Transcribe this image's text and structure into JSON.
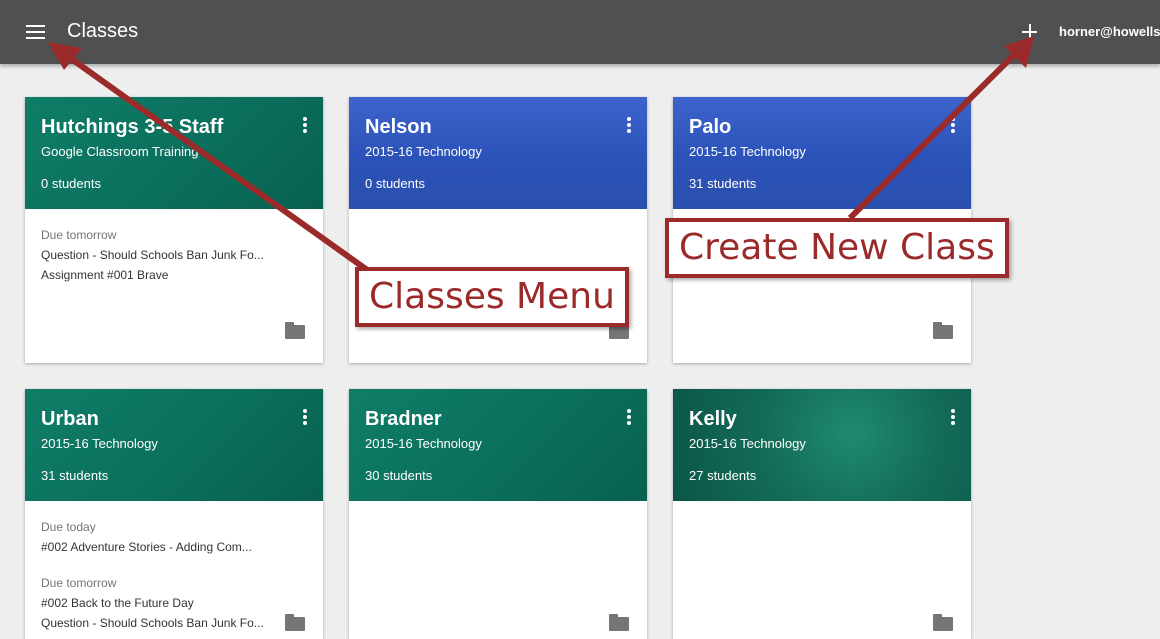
{
  "header": {
    "title": "Classes",
    "account": "horner@howellsc"
  },
  "classes": [
    {
      "name": "Hutchings 3-5 Staff",
      "section": "Google Classroom Training",
      "students": "0 students",
      "theme": "teal",
      "assignments": [
        {
          "due": "Due tomorrow",
          "items": [
            "Question - Should Schools Ban Junk Fo...",
            "Assignment #001 Brave"
          ]
        }
      ]
    },
    {
      "name": "Nelson",
      "section": "2015-16 Technology",
      "students": "0 students",
      "theme": "blue",
      "assignments": []
    },
    {
      "name": "Palo",
      "section": "2015-16 Technology",
      "students": "31 students",
      "theme": "blue",
      "assignments": []
    },
    {
      "name": "Urban",
      "section": "2015-16 Technology",
      "students": "31 students",
      "theme": "teal",
      "assignments": [
        {
          "due": "Due today",
          "items": [
            "#002 Adventure Stories - Adding Com..."
          ]
        },
        {
          "due": "Due tomorrow",
          "items": [
            "#002 Back to the Future Day",
            "Question - Should Schools Ban Junk Fo..."
          ]
        }
      ]
    },
    {
      "name": "Bradner",
      "section": "2015-16 Technology",
      "students": "30 students",
      "theme": "teal",
      "assignments": []
    },
    {
      "name": "Kelly",
      "section": "2015-16 Technology",
      "students": "27 students",
      "theme": "butterfly",
      "assignments": []
    }
  ],
  "annotations": {
    "classes_menu": "Classes Menu",
    "create_new_class": "Create New Class"
  },
  "colors": {
    "topbar": "#505050",
    "teal": "#0f7d68",
    "blue": "#2e55ba",
    "annotation": "#9b2a2a",
    "background": "#eeeeee"
  },
  "icons": [
    "menu-icon",
    "add-icon",
    "more-vert-icon",
    "folder-icon"
  ]
}
